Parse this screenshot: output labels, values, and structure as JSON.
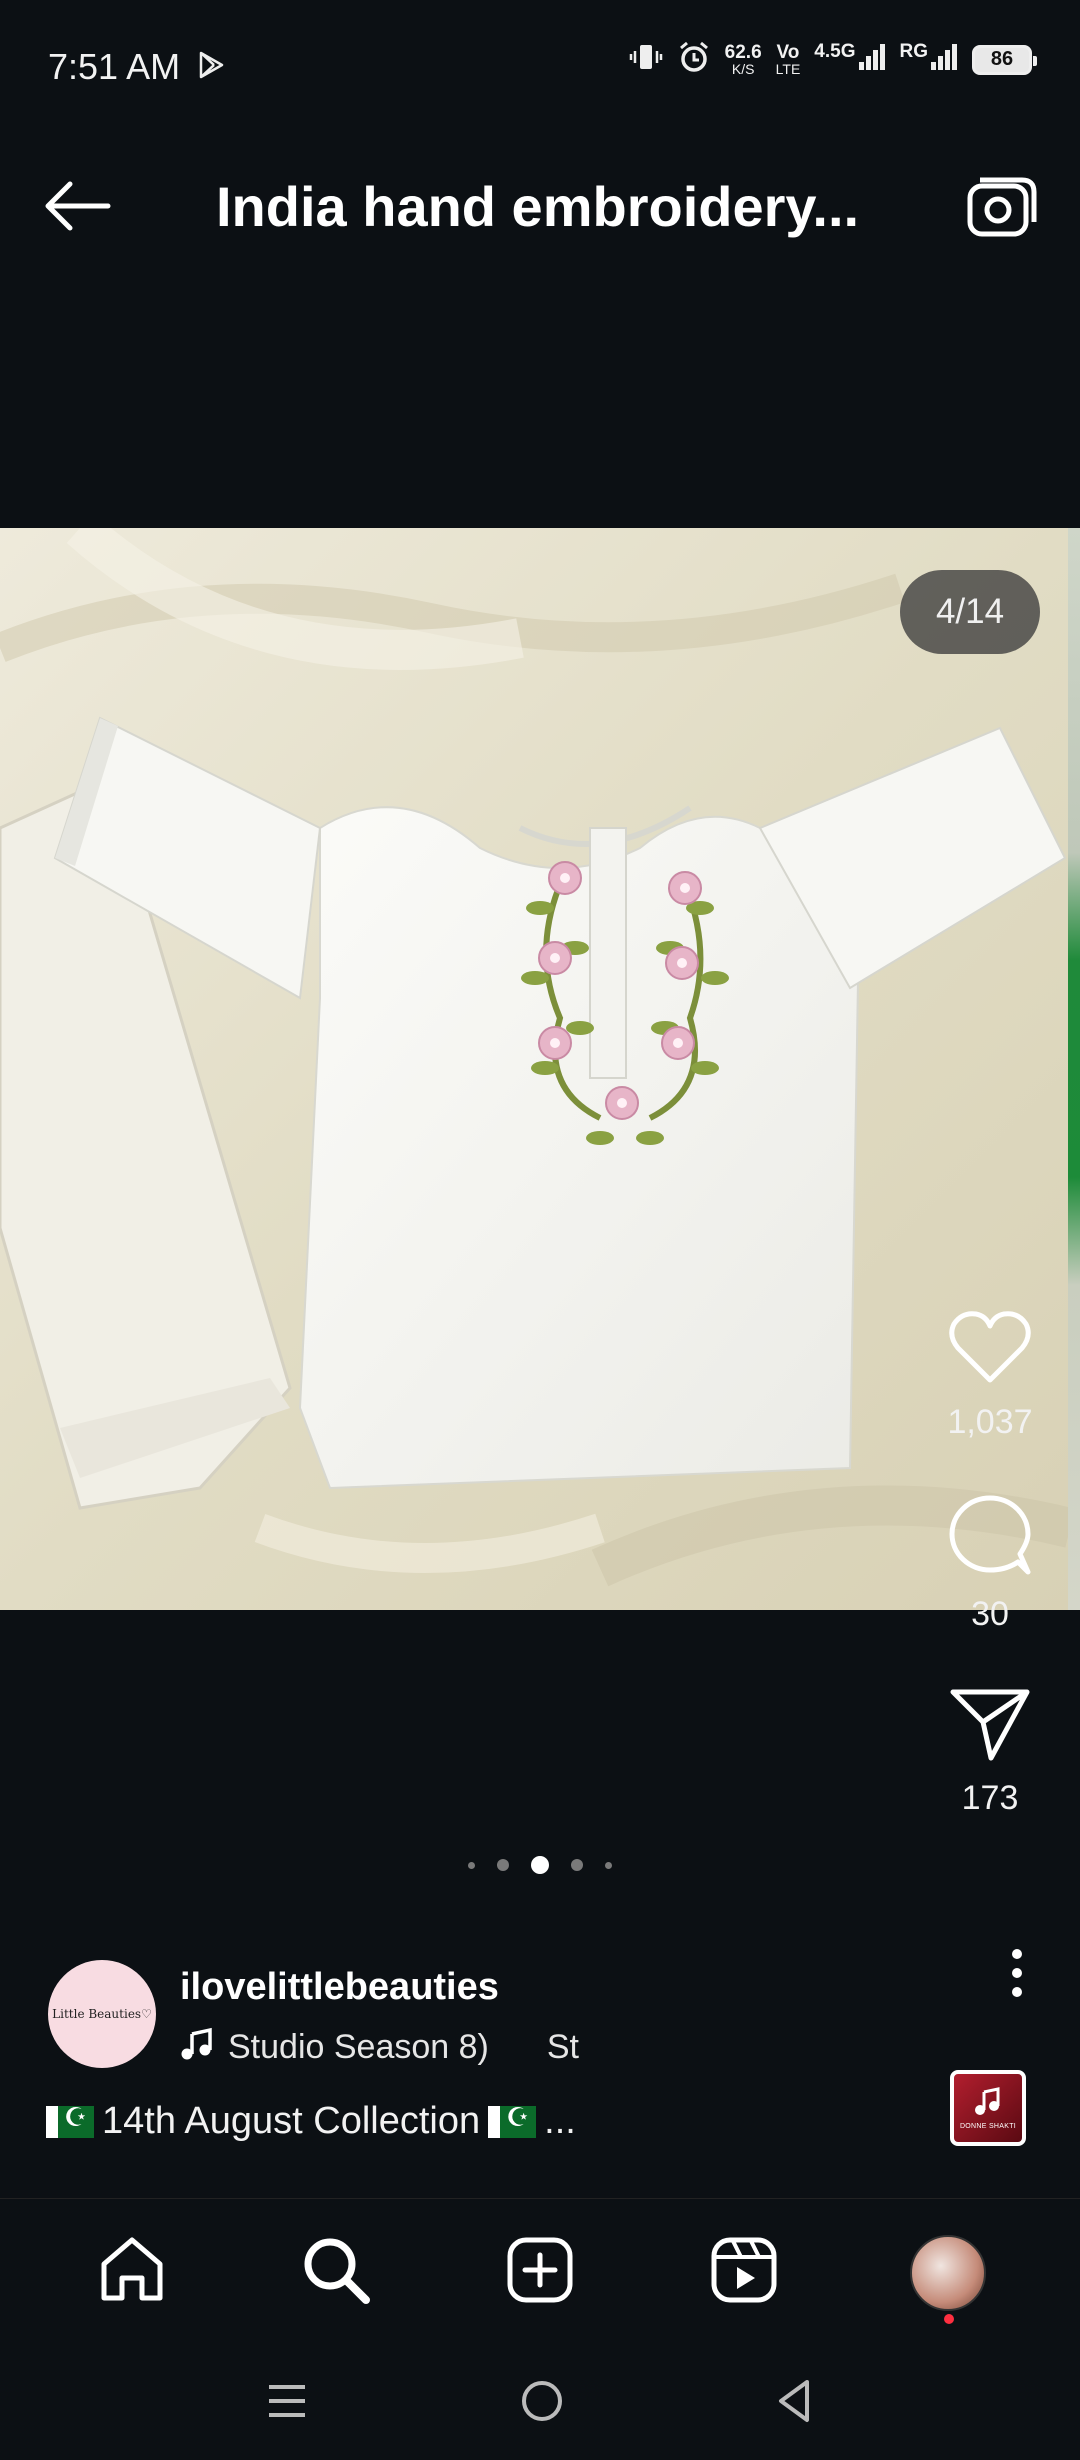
{
  "status_bar": {
    "time": "7:51 AM",
    "net_speed_value": "62.6",
    "net_speed_unit": "K/S",
    "volte_top": "Vo",
    "volte_bottom": "LTE",
    "network_type": "4.5G",
    "carrier": "RG",
    "battery": "86"
  },
  "header": {
    "title": "India hand embroidery..."
  },
  "post": {
    "image_counter": "4/14",
    "likes": "1,037",
    "comments": "30",
    "shares": "173",
    "author": {
      "username": "ilovelittlebeauties",
      "avatar_text": "Little Beauties♡"
    },
    "music": {
      "track": "Studio Season 8)",
      "next_track": "St"
    },
    "caption": "14th August Collection",
    "caption_more": "...",
    "audio_thumb_caption": "DONNE SHAKTI"
  },
  "pagination": {
    "count": 5,
    "active_index": 2
  },
  "colors": {
    "background": "#0c1014",
    "text": "#ffffff",
    "notification_dot": "#ff2f40"
  }
}
